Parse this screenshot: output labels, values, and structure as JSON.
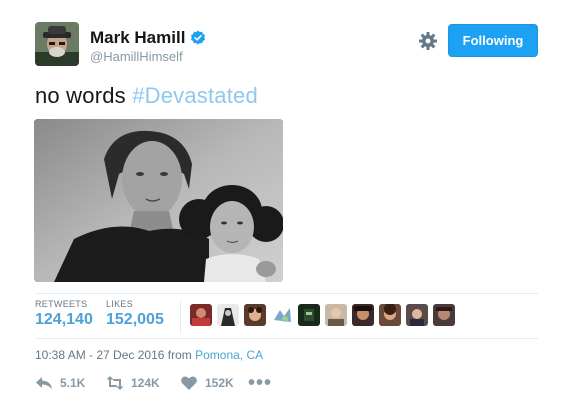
{
  "author": {
    "name": "Mark Hamill",
    "handle": "@HamillHimself",
    "verified": true
  },
  "follow_button": {
    "label": "Following"
  },
  "tweet": {
    "text": "no words",
    "hashtag": "#Devastated"
  },
  "stats": {
    "retweets_label": "RETWEETS",
    "retweets_value": "124,140",
    "likes_label": "LIKES",
    "likes_value": "152,005"
  },
  "timestamp": {
    "text": "10:38 AM - 27 Dec 2016 from",
    "location": "Pomona, CA"
  },
  "actions": {
    "reply_count": "5.1K",
    "retweet_count": "124K",
    "like_count": "152K",
    "more": "•••"
  },
  "colors": {
    "brand_blue": "#1da1f2",
    "link_blue": "#4da1d6",
    "hashtag_blue": "#8dc8ef",
    "muted": "#8899a6"
  }
}
